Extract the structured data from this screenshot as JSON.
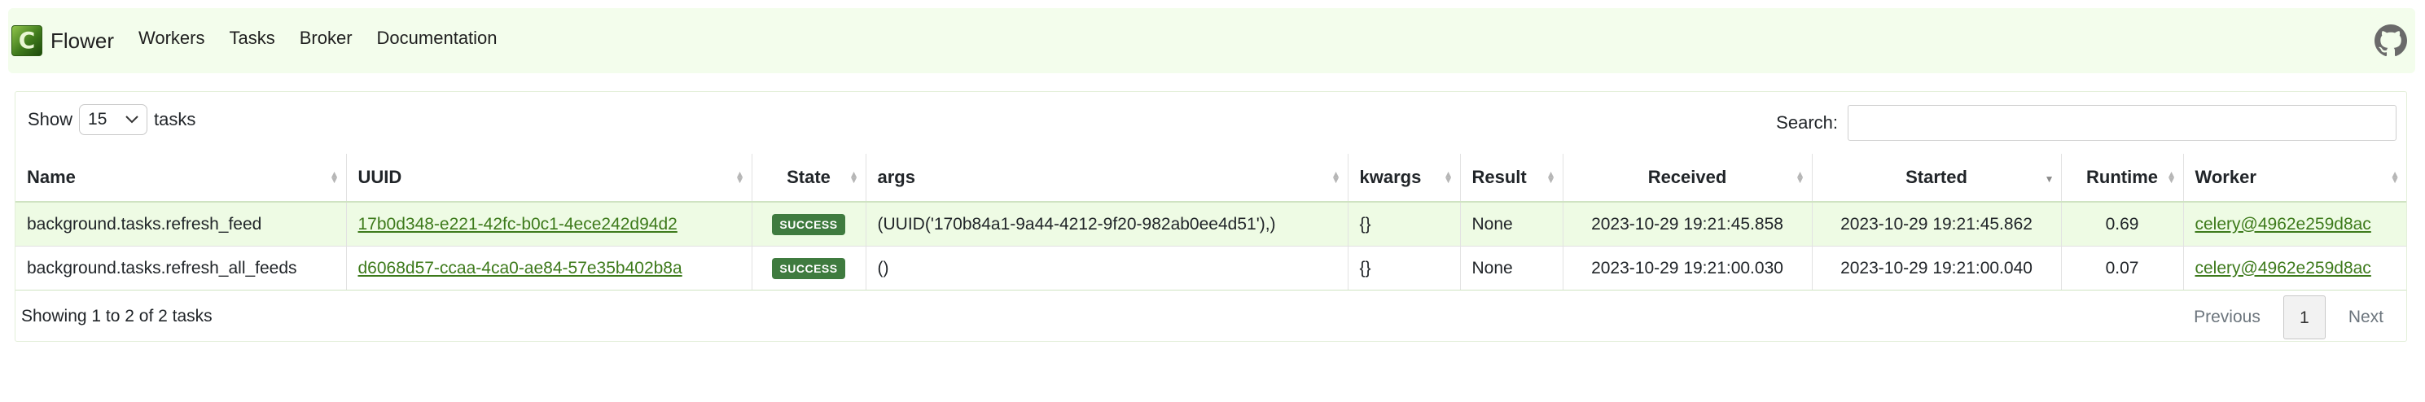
{
  "brand": {
    "logo_letter": "C",
    "name": "Flower"
  },
  "nav": {
    "workers": "Workers",
    "tasks": "Tasks",
    "broker": "Broker",
    "documentation": "Documentation"
  },
  "controls": {
    "show_label": "Show",
    "page_size": "15",
    "tasks_label": "tasks",
    "search_label": "Search:",
    "search_value": ""
  },
  "table": {
    "headers": {
      "name": "Name",
      "uuid": "UUID",
      "state": "State",
      "args": "args",
      "kwargs": "kwargs",
      "result": "Result",
      "received": "Received",
      "started": "Started",
      "runtime": "Runtime",
      "worker": "Worker"
    },
    "sort_column": "Started",
    "sort_direction": "descending",
    "rows": [
      {
        "name": "background.tasks.refresh_feed",
        "uuid": "17b0d348-e221-42fc-b0c1-4ece242d94d2",
        "state": "SUCCESS",
        "args": "(UUID('170b84a1-9a44-4212-9f20-982ab0ee4d51'),)",
        "kwargs": "{}",
        "result": "None",
        "received": "2023-10-29 19:21:45.858",
        "started": "2023-10-29 19:21:45.862",
        "runtime": "0.69",
        "worker": "celery@4962e259d8ac"
      },
      {
        "name": "background.tasks.refresh_all_feeds",
        "uuid": "d6068d57-ccaa-4ca0-ae84-57e35b402b8a",
        "state": "SUCCESS",
        "args": "()",
        "kwargs": "{}",
        "result": "None",
        "received": "2023-10-29 19:21:00.030",
        "started": "2023-10-29 19:21:00.040",
        "runtime": "0.07",
        "worker": "celery@4962e259d8ac"
      }
    ]
  },
  "footer": {
    "info": "Showing 1 to 2 of 2 tasks",
    "previous": "Previous",
    "current_page": "1",
    "next": "Next"
  },
  "colors": {
    "navbar_bg": "#f3fdec",
    "link": "#3d7a1b",
    "success_badge": "#3f7b3f",
    "highlight_row": "#eefbe4"
  }
}
